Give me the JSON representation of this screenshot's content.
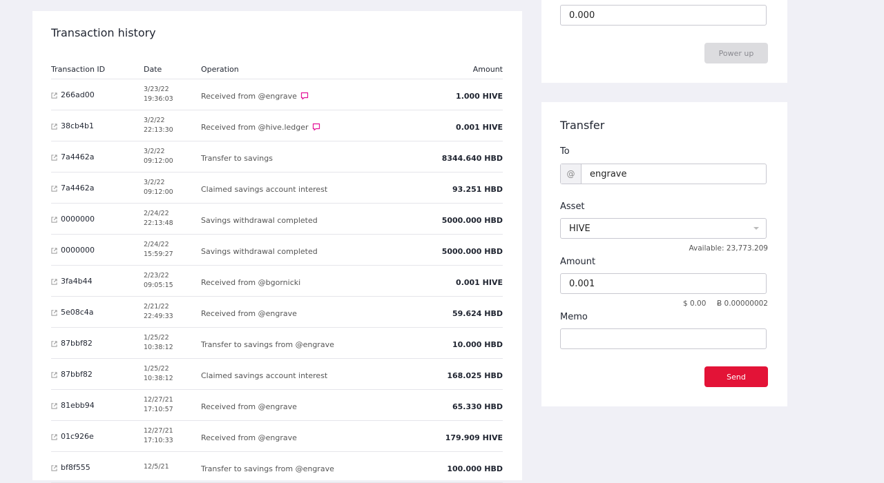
{
  "history": {
    "title": "Transaction history",
    "headers": {
      "id": "Transaction ID",
      "date": "Date",
      "operation": "Operation",
      "amount": "Amount"
    },
    "rows": [
      {
        "id": "266ad00",
        "date": "3/23/22",
        "time": "19:36:03",
        "operation": "Received from @engrave",
        "memo": true,
        "amount": "1.000 HIVE"
      },
      {
        "id": "38cb4b1",
        "date": "3/2/22",
        "time": "22:13:30",
        "operation": "Received from @hive.ledger",
        "memo": true,
        "amount": "0.001 HIVE"
      },
      {
        "id": "7a4462a",
        "date": "3/2/22",
        "time": "09:12:00",
        "operation": "Transfer to savings",
        "memo": false,
        "amount": "8344.640 HBD"
      },
      {
        "id": "7a4462a",
        "date": "3/2/22",
        "time": "09:12:00",
        "operation": "Claimed savings account interest",
        "memo": false,
        "amount": "93.251 HBD"
      },
      {
        "id": "0000000",
        "date": "2/24/22",
        "time": "22:13:48",
        "operation": "Savings withdrawal completed",
        "memo": false,
        "amount": "5000.000 HBD"
      },
      {
        "id": "0000000",
        "date": "2/24/22",
        "time": "15:59:27",
        "operation": "Savings withdrawal completed",
        "memo": false,
        "amount": "5000.000 HBD"
      },
      {
        "id": "3fa4b44",
        "date": "2/23/22",
        "time": "09:05:15",
        "operation": "Received from @bgornicki",
        "memo": false,
        "amount": "0.001 HIVE"
      },
      {
        "id": "5e08c4a",
        "date": "2/21/22",
        "time": "22:49:33",
        "operation": "Received from @engrave",
        "memo": false,
        "amount": "59.624 HBD"
      },
      {
        "id": "87bbf82",
        "date": "1/25/22",
        "time": "10:38:12",
        "operation": "Transfer to savings from @engrave",
        "memo": false,
        "amount": "10.000 HBD"
      },
      {
        "id": "87bbf82",
        "date": "1/25/22",
        "time": "10:38:12",
        "operation": "Claimed savings account interest",
        "memo": false,
        "amount": "168.025 HBD"
      },
      {
        "id": "81ebb94",
        "date": "12/27/21",
        "time": "17:10:57",
        "operation": "Received from @engrave",
        "memo": false,
        "amount": "65.330 HBD"
      },
      {
        "id": "01c926e",
        "date": "12/27/21",
        "time": "17:10:33",
        "operation": "Received from @engrave",
        "memo": false,
        "amount": "179.909 HIVE"
      },
      {
        "id": "bf8f555",
        "date": "12/5/21",
        "time": "",
        "operation": "Transfer to savings from @engrave",
        "memo": false,
        "amount": "100.000 HBD"
      }
    ]
  },
  "powerup": {
    "amount_value": "0.000",
    "button_label": "Power up"
  },
  "transfer": {
    "title": "Transfer",
    "to_label": "To",
    "to_prefix": "@",
    "to_value": "engrave",
    "asset_label": "Asset",
    "asset_value": "HIVE",
    "available": "Available: 23,773.209",
    "amount_label": "Amount",
    "amount_value": "0.001",
    "usd_value": "$ 0.00",
    "btc_value": "Ƀ 0.00000002",
    "memo_label": "Memo",
    "memo_value": "",
    "send_label": "Send"
  },
  "colors": {
    "accent": "#e31337",
    "memo_icon": "#e31398",
    "background": "#f0f0f6"
  }
}
